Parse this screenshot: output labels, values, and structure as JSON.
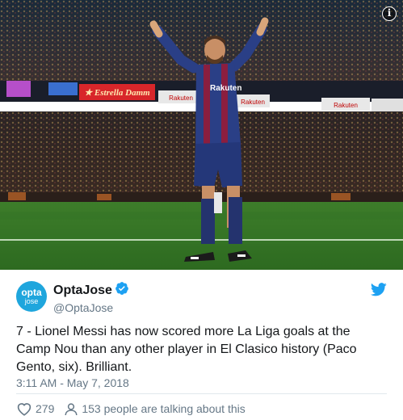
{
  "media": {
    "description_icon": "info-icon",
    "info_label": "i",
    "billboard_estrella": "★ Estrella Damm",
    "billboard_rakuten_1": "Rakuten",
    "billboard_rakuten_2": "Rakuten",
    "billboard_rakuten_3": "Rakuten",
    "shirt_sponsor": "Rakuten"
  },
  "author": {
    "avatar_line1": "opta",
    "avatar_line2": "jose",
    "display_name": "OptaJose",
    "handle": "@OptaJose",
    "verified_icon": "verified-badge-icon",
    "brand_icon": "twitter-bird-icon"
  },
  "tweet": {
    "text": "7 - Lionel Messi has now scored more La Liga goals at the Camp Nou than any other player in El Clasico history (Paco Gento, six). Brilliant.",
    "timestamp": "3:11 AM - May 7, 2018"
  },
  "actions": {
    "likes": "279",
    "conversation": "153 people are talking about this"
  },
  "colors": {
    "brand_blue": "#1da1f2",
    "avatar_blue": "#1fa6dd",
    "muted_text": "#657786",
    "body_text": "#14171a"
  }
}
